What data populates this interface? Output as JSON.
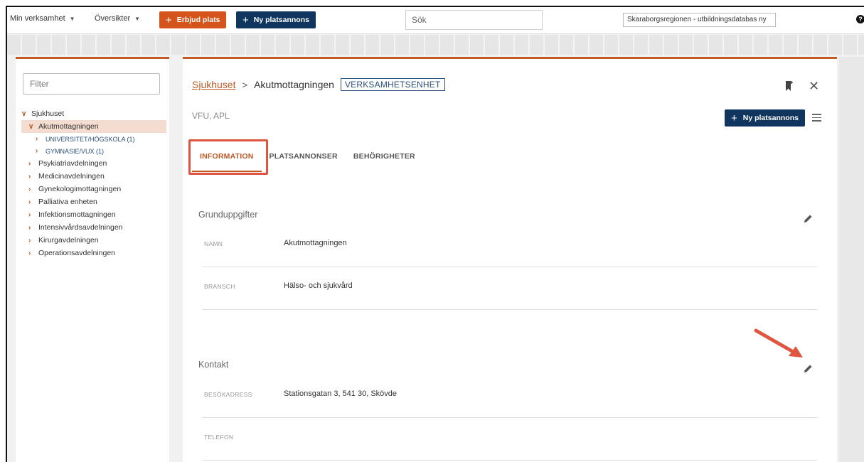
{
  "topbar": {
    "menu1": "Min verksamhet",
    "menu2": "Översikter",
    "btn_offer": "Erbjud plats",
    "btn_new_ad": "Ny platsannons",
    "search_placeholder": "Sök",
    "region": "Skaraborgsregionen - utbildningsdatabas ny",
    "help_glyph": "?"
  },
  "sidebar": {
    "filter_placeholder": "Filter",
    "root": "Sjukhuset",
    "items": [
      {
        "label": "Akutmottagningen",
        "expanded": true,
        "selected": true
      },
      {
        "label": "UNIVERSITET/HÖGSKOLA (1)",
        "child": true
      },
      {
        "label": "GYMNASIE/VUX (1)",
        "child": true
      },
      {
        "label": "Psykiatriavdelningen"
      },
      {
        "label": "Medicinavdelningen"
      },
      {
        "label": "Gynekologimottagningen"
      },
      {
        "label": "Palliativa enheten"
      },
      {
        "label": "Infektionsmottagningen"
      },
      {
        "label": "Intensivvårdsavdelningen"
      },
      {
        "label": "Kirurgavdelningen"
      },
      {
        "label": "Operationsavdelningen"
      }
    ]
  },
  "main": {
    "breadcrumb_parent": "Sjukhuset",
    "breadcrumb_current": "Akutmottagningen",
    "badge": "VERKSAMHETSENHET",
    "subtitle": "VFU, APL",
    "btn_new_ad": "Ny platsannons",
    "tabs": [
      "INFORMATION",
      "PLATSANNONSER",
      "BEHÖRIGHETER"
    ],
    "sections": {
      "basic": {
        "title": "Grunduppgifter",
        "fields": [
          {
            "label": "NAMN",
            "value": "Akutmottagningen"
          },
          {
            "label": "BRANSCH",
            "value": "Hälso- och sjukvård"
          }
        ]
      },
      "contact": {
        "title": "Kontakt",
        "fields": [
          {
            "label": "BESÖKADRESS",
            "value": "Stationsgatan 3, 541 30, Skövde"
          },
          {
            "label": "TELEFON",
            "value": ""
          }
        ]
      }
    }
  },
  "colors": {
    "accent": "#c25a27",
    "navy": "#10365f",
    "annotation": "#e0553f"
  }
}
